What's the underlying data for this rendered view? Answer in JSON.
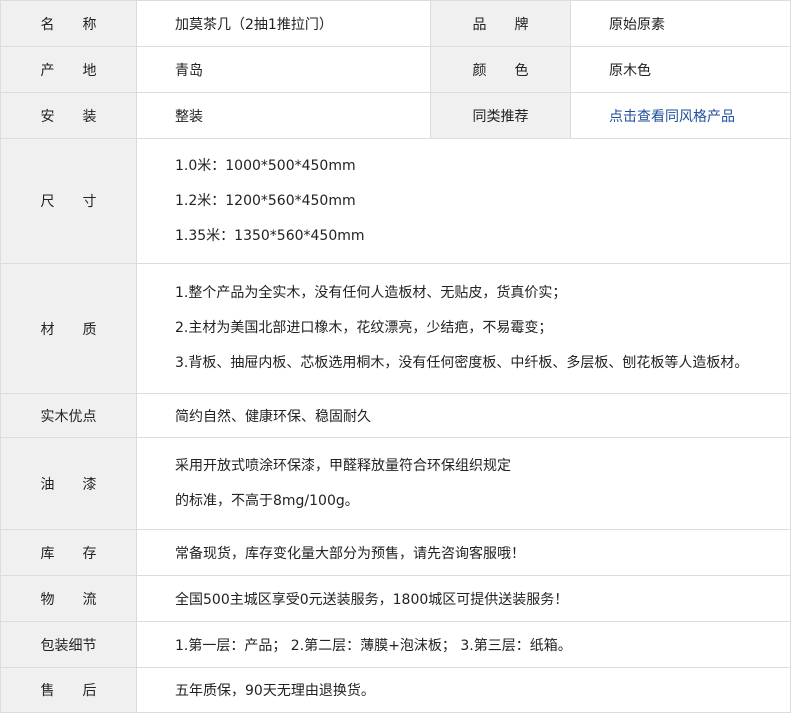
{
  "rows": {
    "name": {
      "label": "名　　称",
      "value": "加莫茶几（2抽1推拉门）"
    },
    "brand": {
      "label": "品　　牌",
      "value": "原始原素"
    },
    "origin": {
      "label": "产　　地",
      "value": "青岛"
    },
    "color": {
      "label": "颜　　色",
      "value": "原木色"
    },
    "install": {
      "label": "安　　装",
      "value": "整装"
    },
    "similar": {
      "label": "同类推荐",
      "link": "点击查看同风格产品"
    },
    "size": {
      "label": "尺　　寸",
      "lines": [
        "1.0米：1000*500*450mm",
        "1.2米：1200*560*450mm",
        "1.35米：1350*560*450mm"
      ]
    },
    "material": {
      "label": "材　　质",
      "lines": [
        "1.整个产品为全实木，没有任何人造板材、无贴皮，货真价实；",
        "2.主材为美国北部进口橡木，花纹漂亮，少结疤，不易霉变；",
        "3.背板、抽屉内板、芯板选用桐木，没有任何密度板、中纤板、多层板、刨花板等人造板材。"
      ]
    },
    "advantage": {
      "label": "实木优点",
      "value": "简约自然、健康环保、稳固耐久"
    },
    "paint": {
      "label": "油　　漆",
      "lines": [
        "采用开放式喷涂环保漆，甲醛释放量符合环保组织规定",
        "的标准，不高于8mg/100g。"
      ]
    },
    "stock": {
      "label": "库　　存",
      "value": "常备现货，库存变化量大部分为预售，请先咨询客服哦！"
    },
    "logistics": {
      "label": "物　　流",
      "value": "全国500主城区享受0元送装服务，1800城区可提供送装服务！"
    },
    "packing": {
      "label": "包装细节",
      "value": "1.第一层：产品； 2.第二层：薄膜+泡沫板； 3.第三层：纸箱。"
    },
    "aftersale": {
      "label": "售　　后",
      "value": "五年质保，90天无理由退换货。"
    }
  }
}
